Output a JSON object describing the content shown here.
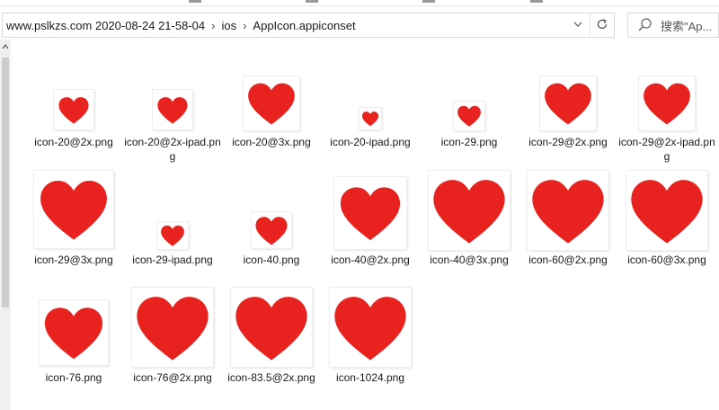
{
  "address": {
    "crumbs": [
      "www.pslkzs.com 2020-08-24 21-58-04",
      "ios",
      "AppIcon.appiconset"
    ],
    "search_placeholder": "搜索\"Ap..."
  },
  "colors": {
    "heart": "#e8231f"
  },
  "files": [
    {
      "name": "icon-20@2x.png"
    },
    {
      "name": "icon-20@2x-ipad.png"
    },
    {
      "name": "icon-20@3x.png"
    },
    {
      "name": "icon-20-ipad.png"
    },
    {
      "name": "icon-29.png"
    },
    {
      "name": "icon-29@2x.png"
    },
    {
      "name": "icon-29@2x-ipad.png"
    },
    {
      "name": "icon-29@3x.png"
    },
    {
      "name": "icon-29-ipad.png"
    },
    {
      "name": "icon-40.png"
    },
    {
      "name": "icon-40@2x.png"
    },
    {
      "name": "icon-40@3x.png"
    },
    {
      "name": "icon-60@2x.png"
    },
    {
      "name": "icon-60@3x.png"
    },
    {
      "name": "icon-76.png"
    },
    {
      "name": "icon-76@2x.png"
    },
    {
      "name": "icon-83.5@2x.png"
    },
    {
      "name": "icon-1024.png"
    }
  ]
}
